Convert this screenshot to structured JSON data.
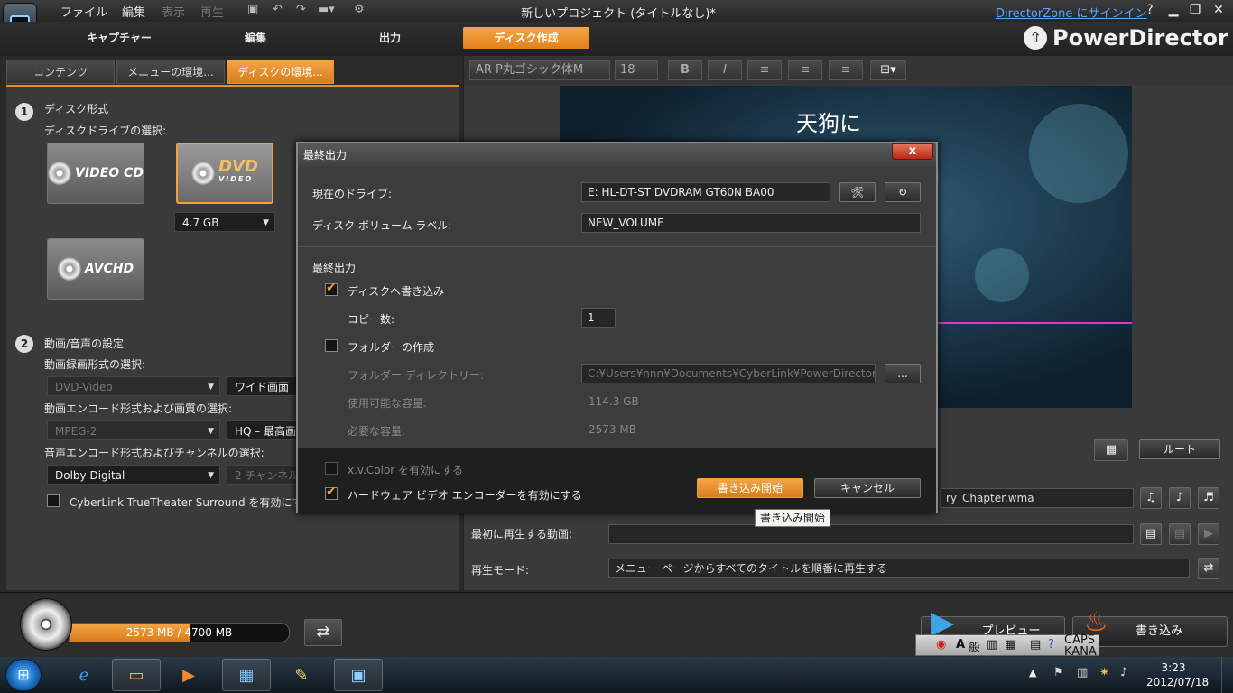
{
  "app": {
    "menu": [
      "ファイル",
      "編集",
      "表示",
      "再生"
    ],
    "window_title": "新しいプロジェクト (タイトルなし)*",
    "signin_link": "DirectorZone にサインイン",
    "help": "?",
    "brand": "PowerDirector"
  },
  "modes": [
    "キャプチャー",
    "編集",
    "出力",
    "ディスク作成"
  ],
  "left_tabs": [
    "コンテンツ",
    "メニューの環境...",
    "ディスクの環境..."
  ],
  "disc": {
    "step1_num": "1",
    "step1_title": "ディスク形式",
    "drive_select_label": "ディスクドライブの選択:",
    "formats": [
      "VIDEO CD",
      "DVD",
      "AVCHD"
    ],
    "dvd_sub": "VIDEO",
    "capacity": "4.7 GB",
    "step2_num": "2",
    "step2_title": "動画/音声の設定",
    "record_format_label": "動画録画形式の選択:",
    "record_format": "DVD-Video",
    "aspect": "ワイド画面",
    "encode_label": "動画エンコード形式および画質の選択:",
    "encode_format": "MPEG-2",
    "quality": "HQ – 最高画",
    "audio_label": "音声エンコード形式およびチャンネルの選択:",
    "audio_format": "Dolby Digital",
    "audio_channel": "2 チャンネル",
    "truetheater_label": "CyberLink TrueTheater Surround を有効にす"
  },
  "format_bar": {
    "font": "AR P丸ゴシック体M",
    "size": "18"
  },
  "preview": {
    "title_text": "天狗に"
  },
  "right_controls": {
    "root_button": "ルート",
    "bgm_file": "ry_Chapter.wma",
    "first_play_label": "最初に再生する動画:",
    "first_play_value": "",
    "playback_mode_label": "再生モード:",
    "playback_mode_value": "メニュー ページからすべてのタイトルを順番に再生する"
  },
  "capacity_bar": {
    "used_label": "2573 MB",
    "sep": "/",
    "total_label": "4700 MB",
    "fraction": 0.547
  },
  "bottom_buttons": {
    "preview": "プレビュー",
    "burn": "書き込み"
  },
  "dialog": {
    "title": "最終出力",
    "close": "x",
    "drive_label": "現在のドライブ:",
    "drive_value": "E: HL-DT-ST DVDRAM GT60N BA00",
    "volume_label_label": "ディスク ボリューム ラベル:",
    "volume_label_value": "NEW_VOLUME",
    "section_title": "最終出力",
    "write_to_disc": "ディスクへ書き込み",
    "copies_label": "コピー数:",
    "copies_value": "1",
    "create_folder": "フォルダーの作成",
    "folder_dir_label": "フォルダー ディレクトリー:",
    "folder_dir_value": "C:¥Users¥nnn¥Documents¥CyberLink¥PowerDirector¥",
    "browse": "...",
    "available_label": "使用可能な容量:",
    "available_value": "114.3 GB",
    "required_label": "必要な容量:",
    "required_value": "2573 MB",
    "xvcolor": "x.v.Color を有効にする",
    "hw_encoder": "ハードウェア ビデオ エンコーダーを有効にする",
    "start_burn": "書き込み開始",
    "cancel": "キャンセル"
  },
  "tooltip": "書き込み開始",
  "ime": {
    "mode": "A",
    "kanji": "般",
    "caps": "CAPS",
    "kana": "KANA"
  },
  "clock": {
    "time": "3:23",
    "date": "2012/07/18"
  },
  "colors": {
    "accent": "#e8891f",
    "link": "#5aa8ff",
    "preview_line": "#d23cd2"
  }
}
